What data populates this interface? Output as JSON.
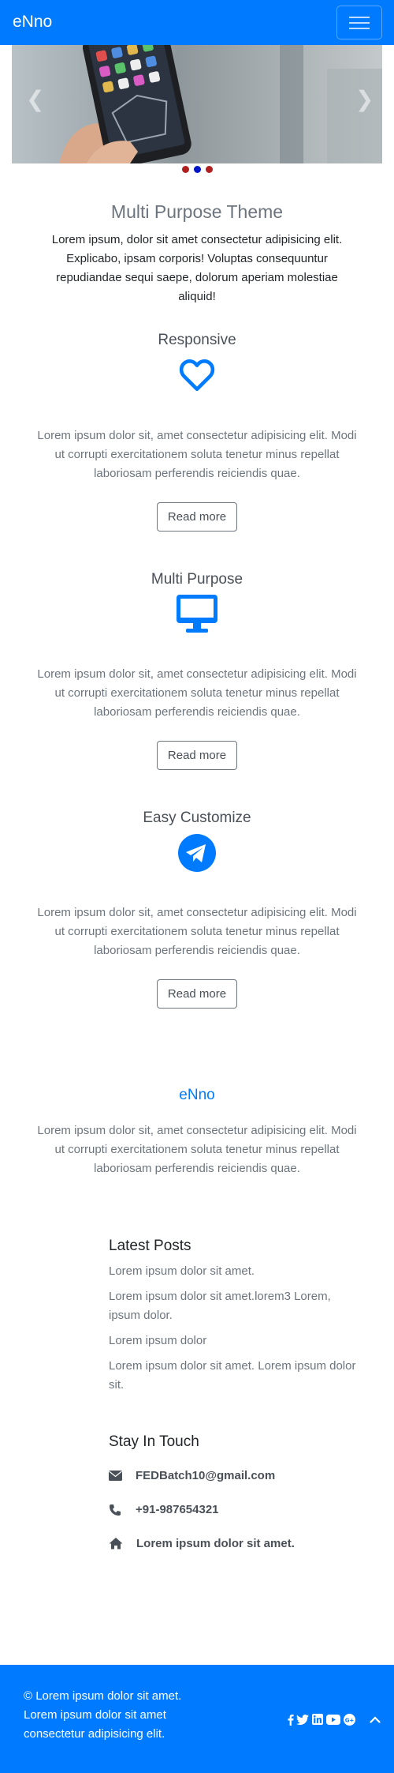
{
  "navbar": {
    "brand": "eNno",
    "toggle_icon": "hamburger-icon"
  },
  "carousel": {
    "slides": 3,
    "active_slide": 2,
    "prev_icon": "chevron-left-icon",
    "next_icon": "chevron-right-icon"
  },
  "hero": {
    "title": "Multi Purpose Theme",
    "text": "Lorem ipsum, dolor sit amet consectetur adipisicing elit. Explicabo, ipsam corporis! Voluptas consequuntur repudiandae sequi saepe, dolorum aperiam molestiae aliquid!"
  },
  "features": [
    {
      "title": "Responsive",
      "icon": "heart-icon",
      "text": "Lorem ipsum dolor sit, amet consectetur adipisicing elit. Modi ut corrupti exercitationem soluta tenetur minus repellat laboriosam perferendis reiciendis quae.",
      "button": "Read more"
    },
    {
      "title": "Multi Purpose",
      "icon": "desktop-icon",
      "text": "Lorem ipsum dolor sit, amet consectetur adipisicing elit. Modi ut corrupti exercitationem soluta tenetur minus repellat laboriosam perferendis reiciendis quae.",
      "button": "Read more"
    },
    {
      "title": "Easy Customize",
      "icon": "telegram-icon",
      "text": "Lorem ipsum dolor sit, amet consectetur adipisicing elit. Modi ut corrupti exercitationem soluta tenetur minus repellat laboriosam perferendis reiciendis quae.",
      "button": "Read more"
    }
  ],
  "about": {
    "title": "eNno",
    "text": "Lorem ipsum dolor sit, amet consectetur adipisicing elit. Modi ut corrupti exercitationem soluta tenetur minus repellat laboriosam perferendis reiciendis quae."
  },
  "latest_posts": {
    "title": "Latest Posts",
    "items": [
      "Lorem ipsum dolor sit amet.",
      "Lorem ipsum dolor sit amet.lorem3 Lorem, ipsum dolor.",
      "Lorem ipsum dolor",
      "Lorem ipsum dolor sit amet. Lorem ipsum dolor sit."
    ]
  },
  "stay_in_touch": {
    "title": "Stay In Touch",
    "email": "FEDBatch10@gmail.com",
    "phone": "+91-987654321",
    "address": "Lorem ipsum dolor sit amet."
  },
  "footer": {
    "text": "© Lorem ipsum dolor sit amet. Lorem ipsum dolor sit amet consectetur adipisicing elit.",
    "social": [
      "facebook-icon",
      "twitter-icon",
      "linkedin-icon",
      "youtube-icon",
      "google-plus-icon"
    ],
    "scroll_top_icon": "chevron-up-icon"
  },
  "colors": {
    "primary": "#007bff",
    "text": "#6c757d",
    "dark": "#212529",
    "dot": "#b02020",
    "dot_active": "#0015c8"
  }
}
